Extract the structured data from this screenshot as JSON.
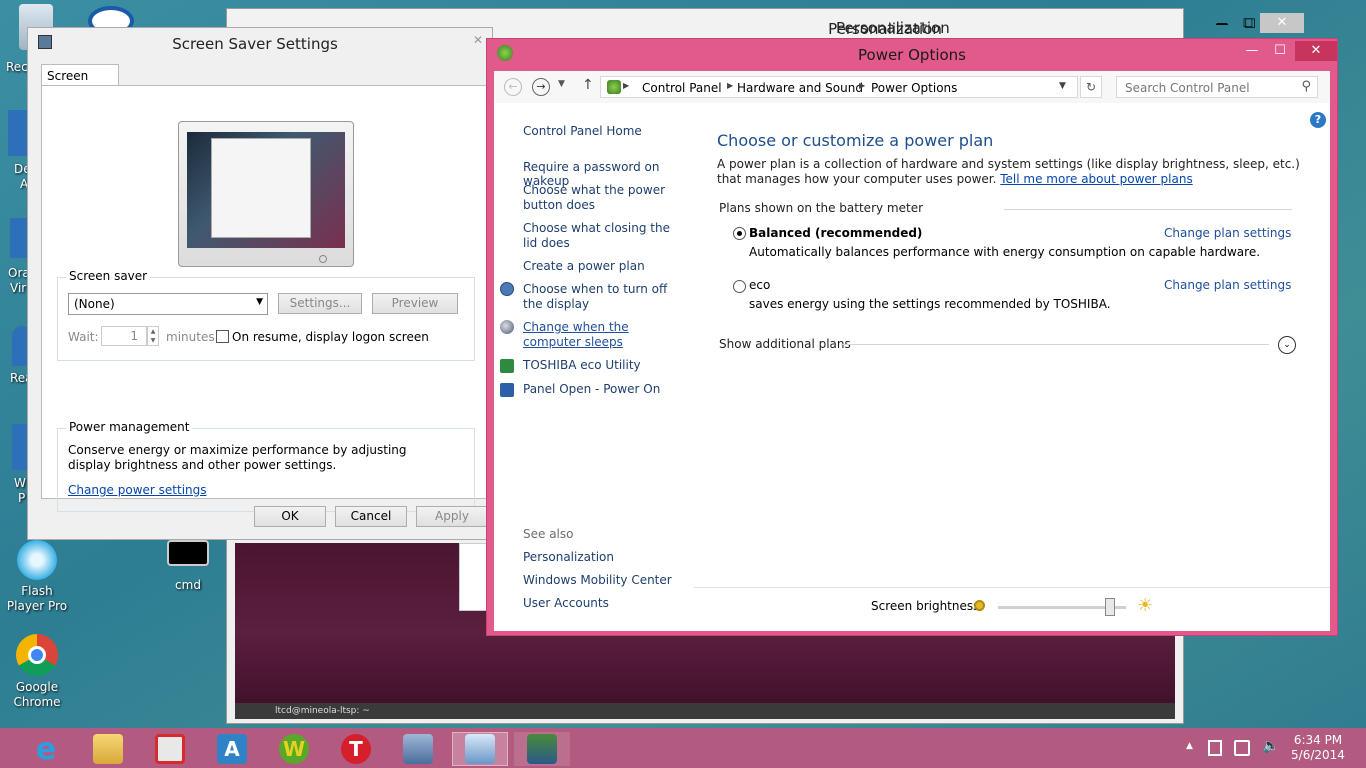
{
  "desktop": {
    "icons": [
      {
        "label": "Flash Player Pro"
      },
      {
        "label": "cmd"
      },
      {
        "label": "Google Chrome"
      }
    ],
    "left_fragments": [
      "Rec",
      "De",
      "A",
      "Ora",
      "Vir",
      "Rea",
      "W",
      "P"
    ]
  },
  "personalization": {
    "title": "Personalization"
  },
  "terminal": {
    "tab_label": "ltcd@mineola-ltsp: ~"
  },
  "screensaver": {
    "title": "Screen Saver Settings",
    "tab": "Screen Saver",
    "group_screensaver": "Screen saver",
    "selected": "(None)",
    "settings_btn": "Settings...",
    "preview_btn": "Preview",
    "wait_label": "Wait:",
    "wait_value": "1",
    "minutes_label": "minutes",
    "resume_label": "On resume, display logon screen",
    "group_power": "Power management",
    "power_text": "Conserve energy or maximize performance by adjusting display brightness and other power settings.",
    "power_link": "Change power settings",
    "ok": "OK",
    "cancel": "Cancel",
    "apply": "Apply"
  },
  "power": {
    "title": "Power Options",
    "breadcrumb": [
      "Control Panel",
      "Hardware and Sound",
      "Power Options"
    ],
    "search_placeholder": "Search Control Panel",
    "sidebar": {
      "home": "Control Panel Home",
      "links": [
        "Require a password on wakeup",
        "Choose what the power button does",
        "Choose what closing the lid does",
        "Create a power plan",
        "Choose when to turn off the display",
        "Change when the computer sleeps",
        "TOSHIBA eco Utility",
        "Panel Open - Power On"
      ],
      "see_also": "See also",
      "see_also_links": [
        "Personalization",
        "Windows Mobility Center",
        "User Accounts"
      ]
    },
    "heading": "Choose or customize a power plan",
    "description": "A power plan is a collection of hardware and system settings (like display brightness, sleep, etc.) that manages how your computer uses power.",
    "more_link": "Tell me more about power plans",
    "plans_header": "Plans shown on the battery meter",
    "plans": [
      {
        "name": "Balanced (recommended)",
        "desc": "Automatically balances performance with energy consumption on capable hardware.",
        "link": "Change plan settings",
        "selected": true
      },
      {
        "name": "eco",
        "desc": "saves energy using the settings recommended by TOSHIBA.",
        "link": "Change plan settings",
        "selected": false
      }
    ],
    "show_additional": "Show additional plans",
    "brightness_label": "Screen brightness:",
    "brightness_level": 0.8
  },
  "taskbar": {
    "time": "6:34 PM",
    "date": "5/6/2014"
  },
  "colors": {
    "accent": "#e25a8c",
    "taskbar": "#b35a80",
    "link": "#0645ad",
    "heading": "#1e4e8c"
  }
}
